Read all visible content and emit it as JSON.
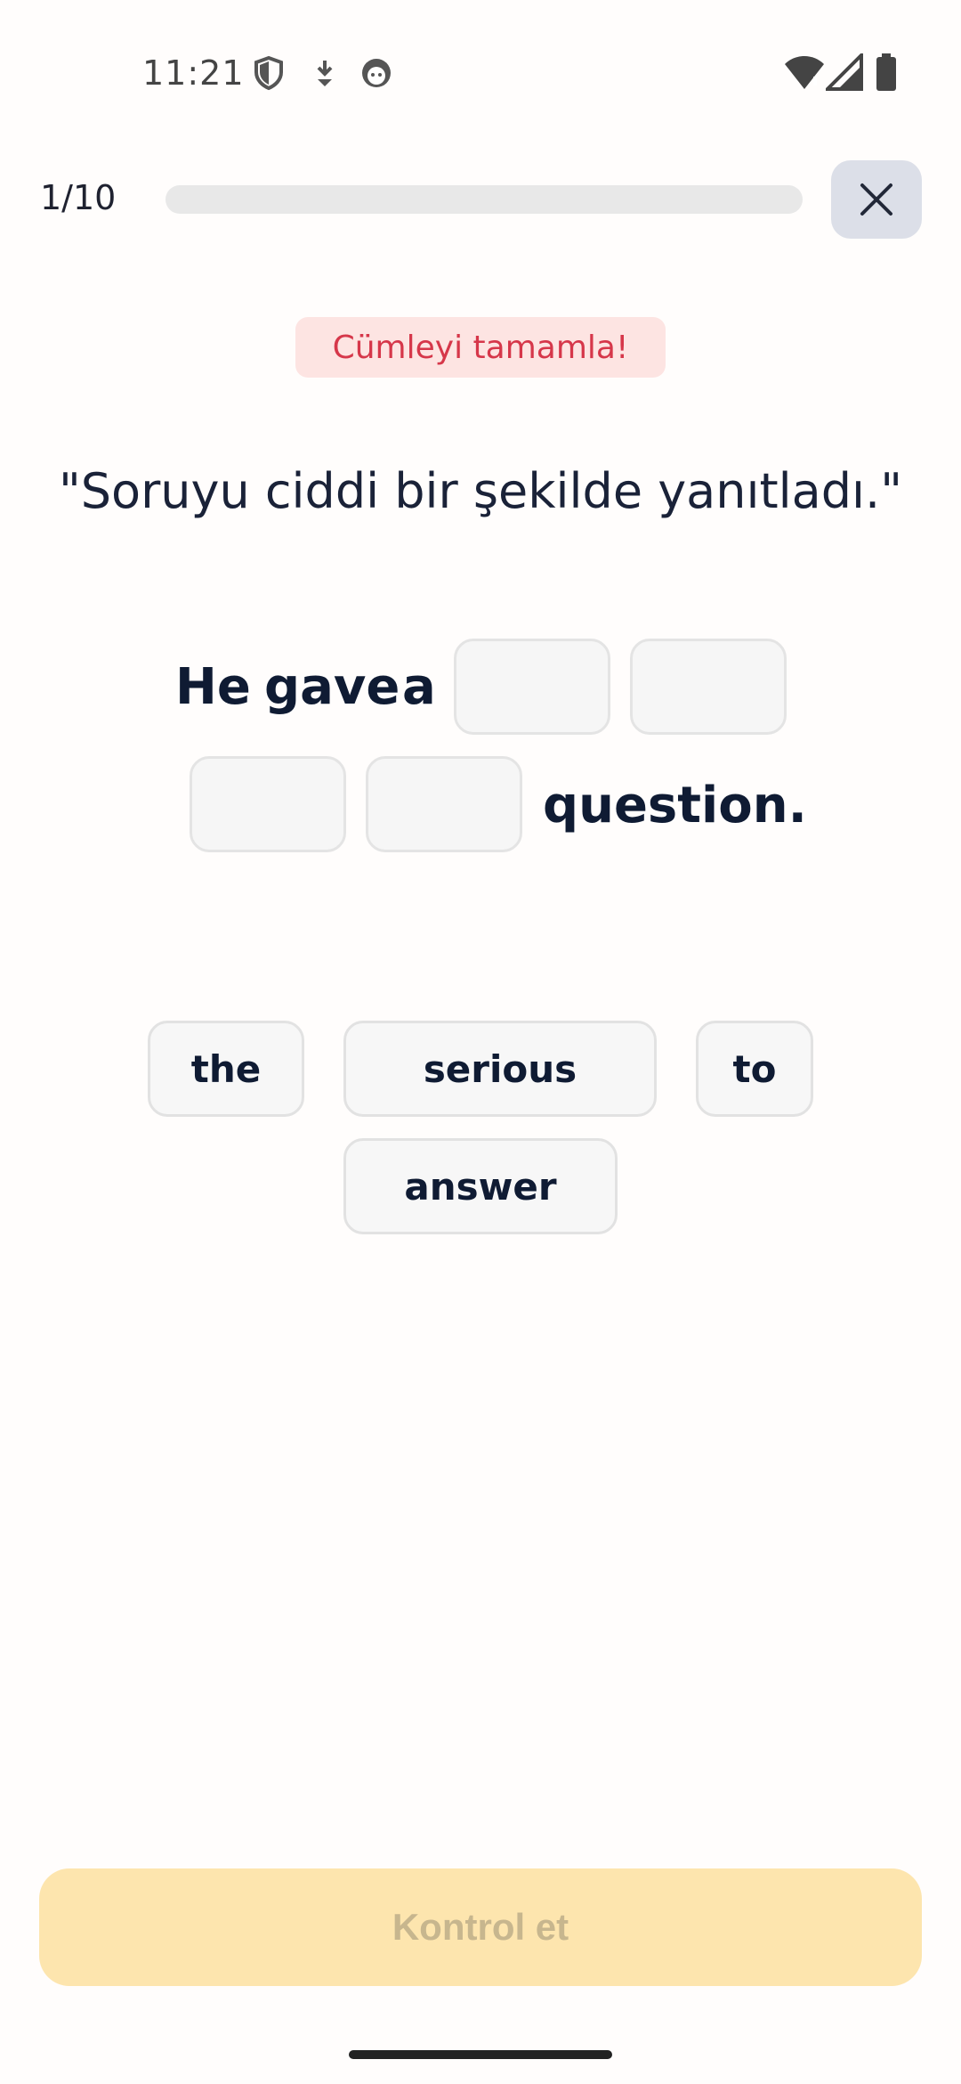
{
  "status_bar": {
    "time": "11:21"
  },
  "header": {
    "progress_text": "1/10",
    "progress_fraction": 0.0,
    "close_icon": "close-icon"
  },
  "exercise": {
    "instruction": "Cümleyi tamamla!",
    "prompt": "\"Soruyu ciddi bir şekilde yanıtladı.\"",
    "sentence_words": [
      "He",
      "gave",
      "a",
      "question."
    ],
    "word_bank": [
      "the",
      "serious",
      "to",
      "answer"
    ]
  },
  "footer": {
    "check_label": "Kontrol et"
  },
  "colors": {
    "accent": "#fde5ae",
    "instruction_bg": "#fde4e2",
    "instruction_text": "#d6374a"
  }
}
